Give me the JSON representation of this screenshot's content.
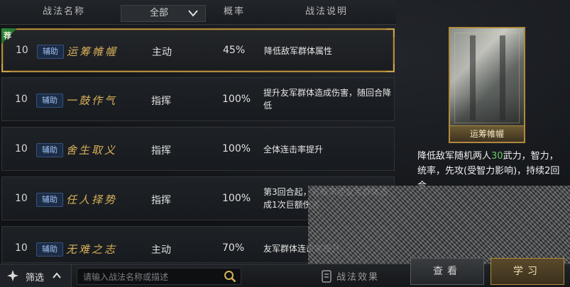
{
  "header": {
    "col_name": "战法名称",
    "filter_value": "全部",
    "col_rate": "概率",
    "col_desc": "战法说明"
  },
  "rows": [
    {
      "recommended": "荐",
      "level": "10",
      "tag": "辅助",
      "name": "运筹帷幄",
      "type": "主动",
      "rate": "45%",
      "desc": "降低敌军群体属性"
    },
    {
      "level": "10",
      "tag": "辅助",
      "name": "一鼓作气",
      "type": "指挥",
      "rate": "100%",
      "desc": "提升友军群体造成伤害，随回合降低"
    },
    {
      "level": "10",
      "tag": "辅助",
      "name": "舍生取义",
      "type": "指挥",
      "rate": "100%",
      "desc": "全体连击率提升"
    },
    {
      "level": "10",
      "tag": "辅助",
      "name": "任人择势",
      "type": "指挥",
      "rate": "100%",
      "desc": "第3回合起，有概率使友军群体造成1次巨额伤害"
    },
    {
      "level": "10",
      "tag": "辅助",
      "name": "无难之志",
      "type": "主动",
      "rate": "70%",
      "desc": "友军群体连击率提升"
    }
  ],
  "footer": {
    "filter_label": "筛选",
    "search_placeholder": "请输入战法名称或描述",
    "effect_label": "战法效果",
    "view_label": "查看",
    "learn_label": "学习"
  },
  "detail": {
    "card_title": "运筹帷幄",
    "text_before": "降低敌军随机两人",
    "highlight": "30",
    "text_after": "武力，智力，统率，先攻(受智力影响)，持续2回合"
  },
  "colors": {
    "accent_gold": "#b08a3e",
    "skill_name": "#d9b15a",
    "tag_blue": "#9fc0f0",
    "highlight_green": "#66cc66",
    "recommend_green": "#2f8a3a"
  }
}
